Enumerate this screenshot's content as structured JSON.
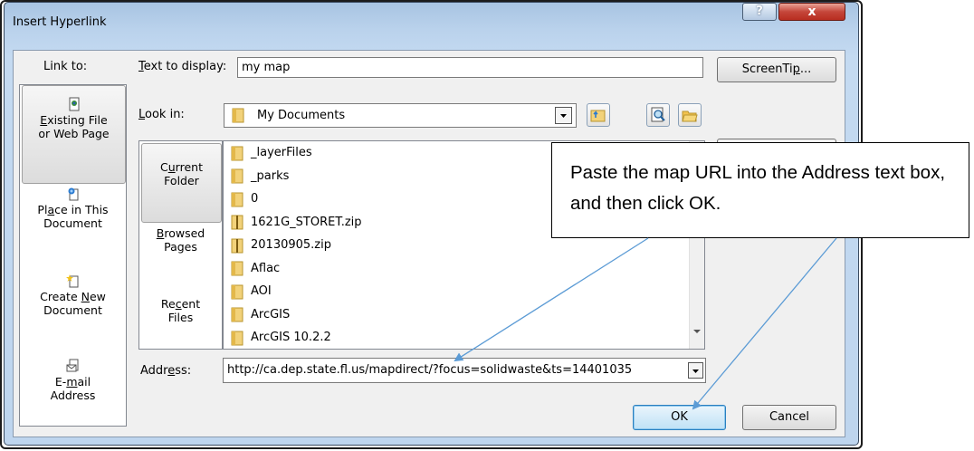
{
  "window": {
    "title": "Insert Hyperlink",
    "help_label": "?",
    "close_label": "x"
  },
  "link_to": {
    "label": "Link to:",
    "items": [
      {
        "line1_pre": "",
        "line1_key": "E",
        "line1_post": "xisting File",
        "line2": "or Web Page",
        "selected": true,
        "icon": "document-globe-icon"
      },
      {
        "line1_pre": "Pl",
        "line1_key": "a",
        "line1_post": "ce in This",
        "line2": "Document",
        "selected": false,
        "icon": "place-document-icon"
      },
      {
        "line1_pre": "Create ",
        "line1_key": "N",
        "line1_post": "ew",
        "line2": "Document",
        "selected": false,
        "icon": "new-document-icon"
      },
      {
        "line1_pre": "E-",
        "line1_key": "m",
        "line1_post": "ail",
        "line2": "Address",
        "selected": false,
        "icon": "email-icon"
      }
    ]
  },
  "text_to_display": {
    "label_key": "T",
    "label_rest": "ext to display:",
    "value": "my map"
  },
  "screentip": {
    "label_pre": "ScreenTi",
    "label_key": "p",
    "label_post": "..."
  },
  "look_in": {
    "label_key": "L",
    "label_rest": "ook in:",
    "value": "My Documents"
  },
  "sub_nav": [
    {
      "line1_pre": "C",
      "line1_key": "u",
      "line1_post": "rrent",
      "line2": "Folder",
      "selected": true
    },
    {
      "line1_pre": "",
      "line1_key": "B",
      "line1_post": "rowsed",
      "line2": "Pages",
      "selected": false
    },
    {
      "line1_pre": "Re",
      "line1_key": "c",
      "line1_post": "ent",
      "line2": "Files",
      "selected": false
    }
  ],
  "files": [
    {
      "name": "_layerFiles",
      "kind": "folder"
    },
    {
      "name": "_parks",
      "kind": "folder"
    },
    {
      "name": "0",
      "kind": "folder"
    },
    {
      "name": "1621G_STORET.zip",
      "kind": "zip"
    },
    {
      "name": "20130905.zip",
      "kind": "zip"
    },
    {
      "name": "Aflac",
      "kind": "folder"
    },
    {
      "name": "AOI",
      "kind": "folder"
    },
    {
      "name": "ArcGIS",
      "kind": "folder"
    },
    {
      "name": "ArcGIS 10.2.2",
      "kind": "folder"
    }
  ],
  "address": {
    "label_pre": "Addr",
    "label_key": "e",
    "label_post": "ss:",
    "value": "http://ca.dep.state.fl.us/mapdirect/?focus=solidwaste&ts=14401035"
  },
  "buttons": {
    "ok": "OK",
    "cancel": "Cancel"
  },
  "callout": {
    "text": "Paste the map URL into the Address text box, and then click OK."
  },
  "colors": {
    "accent": "#5b9bd5",
    "title_bar": "#bad2ec",
    "close_red": "#c5463a"
  }
}
